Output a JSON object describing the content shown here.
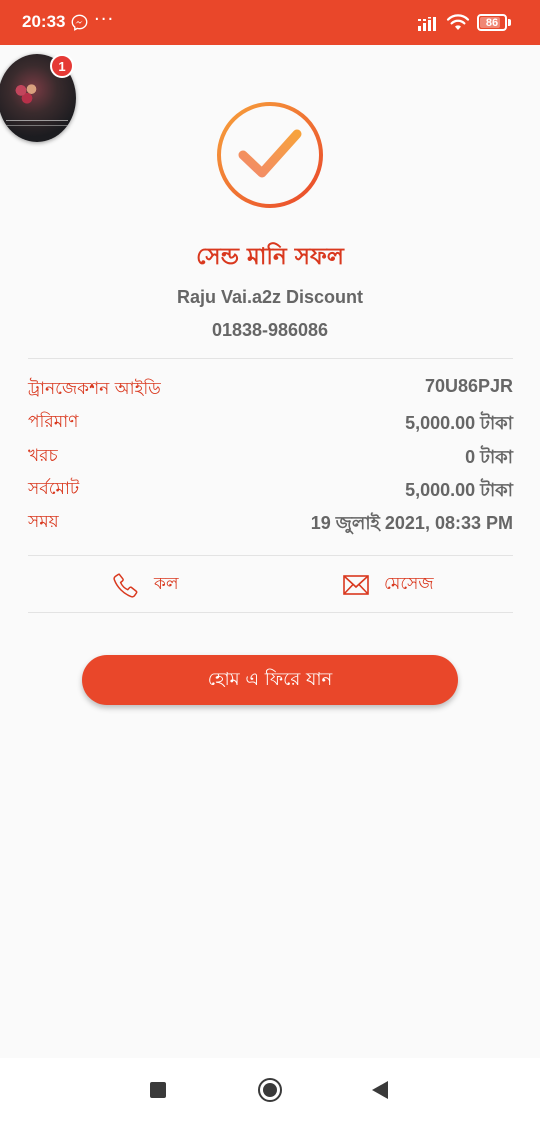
{
  "status_bar": {
    "time": "20:33",
    "more": "···",
    "battery": "86",
    "battery_level": 0.86,
    "background": "#e9472a"
  },
  "chat_head": {
    "badge_count": "1"
  },
  "result": {
    "title": "সেন্ড মানি সফল",
    "recipient_name": "Raju Vai.a2z Discount",
    "recipient_number": "01838-986086"
  },
  "details": [
    {
      "label": "ট্রানজেকশন আইডি",
      "value": "70U86PJR"
    },
    {
      "label": "পরিমাণ",
      "value": "5,000.00 টাকা"
    },
    {
      "label": "খরচ",
      "value": "0 টাকা"
    },
    {
      "label": "সর্বমোট",
      "value": "5,000.00 টাকা"
    },
    {
      "label": "সময়",
      "value": "19 জুলাই 2021, 08:33 PM"
    }
  ],
  "actions": {
    "call_label": "কল",
    "message_label": "মেসেজ"
  },
  "home_button": {
    "label": "হোম এ ফিরে যান"
  },
  "colors": {
    "accent": "#e9472a",
    "label_red": "#d9381e",
    "value_gray": "#666666",
    "check_gradient_start": "#f7a23c",
    "check_gradient_end": "#e9472a"
  },
  "icons": {
    "status": [
      "messenger-icon",
      "signal-icon",
      "wifi-icon",
      "battery-icon"
    ],
    "success": "check-circle-icon",
    "call": "phone-icon",
    "message": "envelope-icon",
    "nav": [
      "recents-square-icon",
      "home-circle-icon",
      "back-triangle-icon"
    ]
  }
}
